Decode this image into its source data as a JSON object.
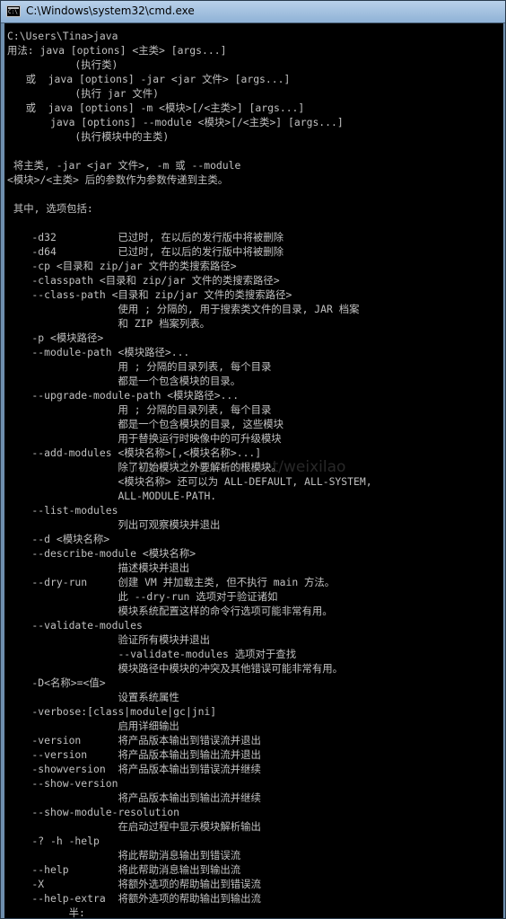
{
  "window": {
    "title": "C:\\Windows\\system32\\cmd.exe"
  },
  "console": {
    "lines": [
      "C:\\Users\\Tina>java",
      "用法: java [options] <主类> [args...]",
      "           (执行类)",
      "   或  java [options] -jar <jar 文件> [args...]",
      "           (执行 jar 文件)",
      "   或  java [options] -m <模块>[/<主类>] [args...]",
      "       java [options] --module <模块>[/<主类>] [args...]",
      "           (执行模块中的主类)",
      "",
      " 将主类, -jar <jar 文件>, -m 或 --module",
      "<模块>/<主类> 后的参数作为参数传递到主类。",
      "",
      " 其中, 选项包括:",
      "",
      "    -d32          已过时, 在以后的发行版中将被删除",
      "    -d64          已过时, 在以后的发行版中将被删除",
      "    -cp <目录和 zip/jar 文件的类搜索路径>",
      "    -classpath <目录和 zip/jar 文件的类搜索路径>",
      "    --class-path <目录和 zip/jar 文件的类搜索路径>",
      "                  使用 ; 分隔的, 用于搜索类文件的目录, JAR 档案",
      "                  和 ZIP 档案列表。",
      "    -p <模块路径>",
      "    --module-path <模块路径>...",
      "                  用 ; 分隔的目录列表, 每个目录",
      "                  都是一个包含模块的目录。",
      "    --upgrade-module-path <模块路径>...",
      "                  用 ; 分隔的目录列表, 每个目录",
      "                  都是一个包含模块的目录, 这些模块",
      "                  用于替换运行时映像中的可升级模块",
      "    --add-modules <模块名称>[,<模块名称>...]",
      "                  除了初始模块之外要解析的根模块。",
      "                  <模块名称> 还可以为 ALL-DEFAULT, ALL-SYSTEM,",
      "                  ALL-MODULE-PATH.",
      "    --list-modules",
      "                  列出可观察模块并退出",
      "    --d <模块名称>",
      "    --describe-module <模块名称>",
      "                  描述模块并退出",
      "    --dry-run     创建 VM 并加载主类, 但不执行 main 方法。",
      "                  此 --dry-run 选项对于验证诸如",
      "                  模块系统配置这样的命令行选项可能非常有用。",
      "    --validate-modules",
      "                  验证所有模块并退出",
      "                  --validate-modules 选项对于查找",
      "                  模块路径中模块的冲突及其他错误可能非常有用。",
      "    -D<名称>=<值>",
      "                  设置系统属性",
      "    -verbose:[class|module|gc|jni]",
      "                  启用详细输出",
      "    -version      将产品版本输出到错误流并退出",
      "    --version     将产品版本输出到输出流并退出",
      "    -showversion  将产品版本输出到错误流并继续",
      "    --show-version",
      "                  将产品版本输出到输出流并继续",
      "    --show-module-resolution",
      "                  在启动过程中显示模块解析输出",
      "    -? -h -help",
      "                  将此帮助消息输出到错误流",
      "    --help        将此帮助消息输出到输出流",
      "    -X            将额外选项的帮助输出到错误流",
      "    --help-extra  将额外选项的帮助输出到输出流",
      "          半:"
    ]
  },
  "watermark": "http://blog.csdn.net/weixilao"
}
